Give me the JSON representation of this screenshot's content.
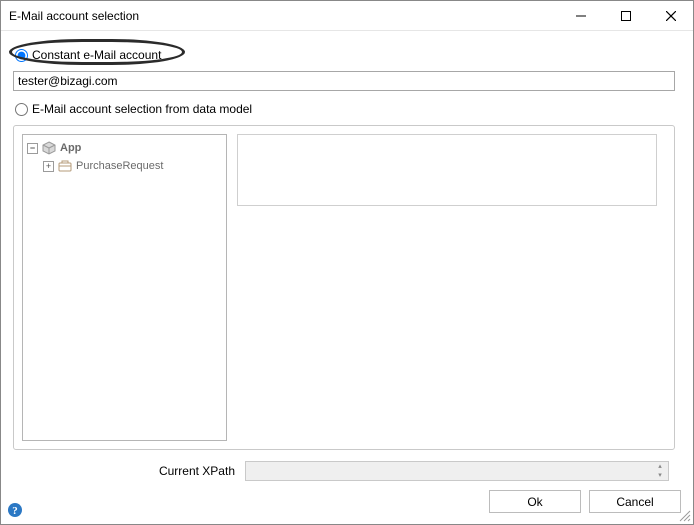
{
  "window": {
    "title": "E-Mail account selection"
  },
  "options": {
    "constant_label": "Constant e-Mail account",
    "datamodel_label": "E-Mail account selection from data model"
  },
  "email": {
    "value": "tester@bizagi.com"
  },
  "tree": {
    "root": "App",
    "child": "PurchaseRequest"
  },
  "xpath": {
    "label": "Current XPath",
    "value": ""
  },
  "buttons": {
    "ok": "Ok",
    "cancel": "Cancel"
  },
  "icons": {
    "minimize": "minimize",
    "maximize": "maximize",
    "close": "close",
    "help": "help",
    "cube": "app-cube",
    "briefcase": "briefcase"
  }
}
